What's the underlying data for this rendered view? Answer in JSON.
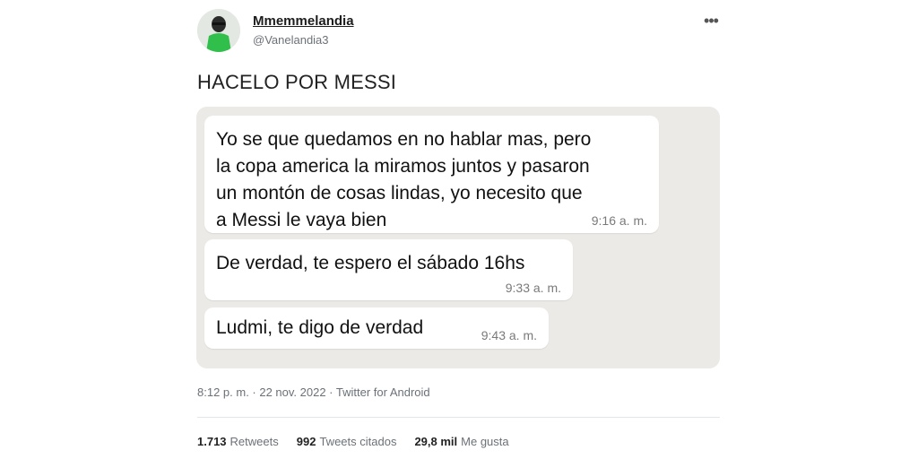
{
  "author": {
    "display_name": "Mmemmelandia",
    "handle": "@Vanelandia3"
  },
  "tweet": {
    "text": "HACELO POR MESSI",
    "more_icon": "more-icon"
  },
  "chat": {
    "messages": [
      {
        "text": "Yo se que quedamos en no hablar mas, pero\nla copa america la miramos juntos y pasaron\nun montón de cosas lindas, yo necesito que\na Messi le vaya bien",
        "time": "9:16 a. m."
      },
      {
        "text": "De verdad, te espero el sábado 16hs",
        "time": "9:33 a. m."
      },
      {
        "text": "Ludmi, te digo de verdad",
        "time": "9:43 a. m."
      }
    ]
  },
  "meta": {
    "line": "8:12 p. m. · 22 nov. 2022 · Twitter for Android"
  },
  "stats": {
    "retweets_count": "1.713",
    "retweets_label": "Retweets",
    "quotes_count": "992",
    "quotes_label": "Tweets citados",
    "likes_count": "29,8 mil",
    "likes_label": "Me gusta"
  },
  "colors": {
    "chat_background": "#eceae6",
    "bubble": "#ffffff",
    "avatar_shirt": "#2fbf4a"
  }
}
